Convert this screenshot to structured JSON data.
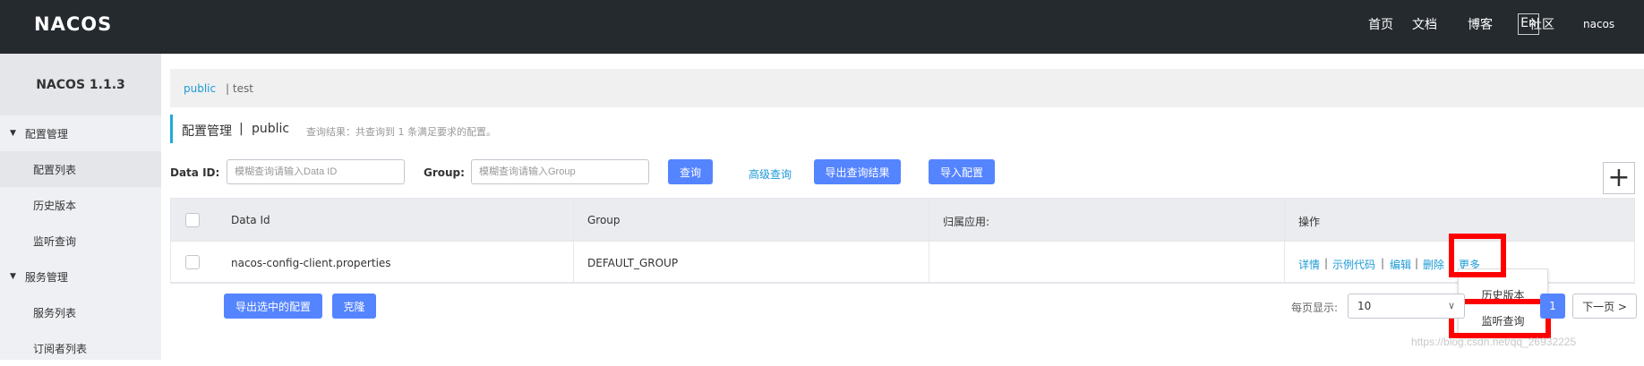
{
  "header": {
    "logo_text": "NACOS",
    "nav": [
      "首页",
      "文档",
      "博客",
      "社区"
    ],
    "lang": "En",
    "user": "nacos"
  },
  "sidebar": {
    "title": "NACOS 1.1.3",
    "groups": [
      {
        "label": "配置管理",
        "items": [
          "配置列表",
          "历史版本",
          "监听查询"
        ]
      },
      {
        "label": "服务管理",
        "items": [
          "服务列表",
          "订阅者列表"
        ]
      }
    ]
  },
  "namespaces": {
    "active": "public",
    "other": "| test"
  },
  "page_header": {
    "title": "配置管理",
    "separator": "|",
    "namespace": "public",
    "query_result": "查询结果：共查询到 1 条满足要求的配置。"
  },
  "search": {
    "data_id_label": "Data ID:",
    "data_id_placeholder": "模糊查询请输入Data ID",
    "group_label": "Group:",
    "group_placeholder": "模糊查询请输入Group",
    "query_button": "查询",
    "advanced_link": "高级查询",
    "export_button": "导出查询结果",
    "import_button": "导入配置",
    "add_button": "+"
  },
  "table": {
    "columns": [
      "Data Id",
      "Group",
      "归属应用:",
      "操作"
    ],
    "rows": [
      {
        "data_id": "nacos-config-client.properties",
        "group": "DEFAULT_GROUP",
        "app": ""
      }
    ],
    "actions": [
      "详情",
      "示例代码",
      "编辑",
      "删除",
      "更多"
    ],
    "action_separator": "|"
  },
  "more_menu": [
    "历史版本",
    "监听查询"
  ],
  "footer": {
    "export_selected": "导出选中的配置",
    "clone": "克隆",
    "page_size_label": "每页显示:",
    "page_size": "10",
    "current_page": "1",
    "next_page": "下一页 >"
  },
  "watermark": "https://blog.csdn.net/qq_26932225",
  "colors": {
    "header_bg": "#252a2f",
    "accent": "#1eabd9",
    "primary_button": "#5584ff",
    "link": "#1c9ad6",
    "highlight": "#ff0000"
  }
}
